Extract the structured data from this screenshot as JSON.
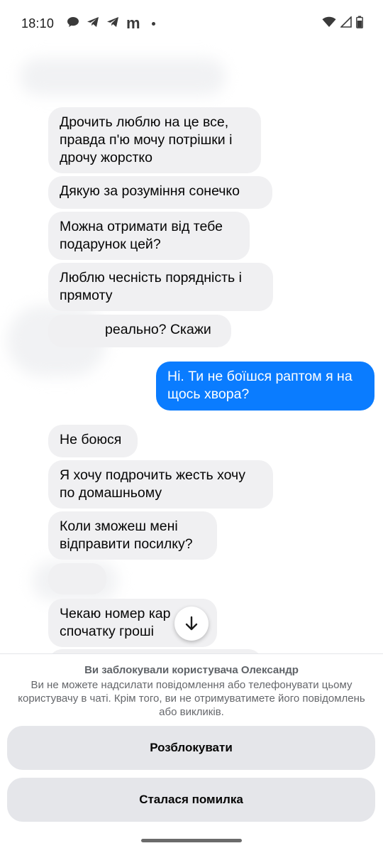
{
  "status_bar": {
    "time": "18:10",
    "left_icons": [
      "chat-bubble-icon",
      "telegram-icon",
      "telegram-icon",
      "m-app-icon",
      "notification-dot"
    ],
    "m_letter": "m",
    "right_icons": [
      "wifi-icon",
      "signal-icon",
      "battery-icon"
    ]
  },
  "messages": [
    {
      "dir": "in",
      "text": "Дрочить люблю на це все,\nправда п'ю мочу потрішки і\nдрочу жорстко"
    },
    {
      "dir": "in",
      "text": "Дякую за розуміння сонечко"
    },
    {
      "dir": "in",
      "text": "Можна отримати від тебе\nподарунок цей?"
    },
    {
      "dir": "in",
      "text": "Люблю чесність порядність і\nпрямоту"
    },
    {
      "dir": "in",
      "text": "реально? Скажи"
    },
    {
      "dir": "out",
      "text": "Ні. Ти не боїшся раптом я на\nщось хвора?"
    },
    {
      "dir": "in",
      "text": "Не боюся"
    },
    {
      "dir": "in",
      "text": "Я хочу подрочить жесть хочу\nпо домашньому"
    },
    {
      "dir": "in",
      "text": "Коли зможеш мені\nвідправити посилку?"
    },
    {
      "dir": "in",
      "text": ""
    },
    {
      "dir": "in",
      "text": "Чекаю номер кар\nспочатку гроші"
    }
  ],
  "blocked": {
    "title": "Ви заблокували користувача Олександр",
    "description": "Ви не можете надсилати повідомлення або телефонувати цьому користувачу в чаті. Крім того, ви не отримуватимете його повідомлень або викликів.",
    "unblock_label": "Розблокувати",
    "error_label": "Сталася помилка"
  },
  "colors": {
    "incoming_bubble": "#f0f0f2",
    "outgoing_bubble": "#0a7cff",
    "button_bg": "#e5e6ea"
  }
}
